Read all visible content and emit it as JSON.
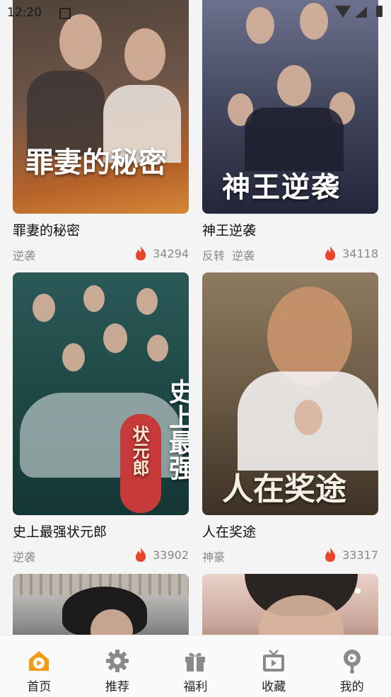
{
  "status": {
    "time": "12:20"
  },
  "cards": [
    {
      "title": "罪妻的秘密",
      "tags": [
        "逆袭"
      ],
      "views": "34294",
      "poster_text": "罪妻的秘密",
      "poster_colors": [
        "#5c4a3e",
        "#b85f2c",
        "#d98a3a"
      ]
    },
    {
      "title": "神王逆袭",
      "tags": [
        "反转",
        "逆袭"
      ],
      "views": "34118",
      "poster_text": "神王逆袭",
      "poster_colors": [
        "#3b3f55",
        "#6a6f87",
        "#2a2d3e"
      ]
    },
    {
      "title": "史上最强状元郎",
      "tags": [
        "逆袭"
      ],
      "views": "33902",
      "poster_text": "史上最强",
      "poster_sub": "状元郎",
      "poster_colors": [
        "#1f4a48",
        "#2f6f6a",
        "#c73a3a"
      ]
    },
    {
      "title": "人在奖途",
      "tags": [
        "神豪"
      ],
      "views": "33317",
      "poster_text": "人在奖途",
      "poster_colors": [
        "#6b5a45",
        "#9a8466",
        "#3e3226"
      ]
    },
    {
      "title": "",
      "tags": [],
      "views": "",
      "poster_colors": [
        "#8f8f8f",
        "#d8d3cd",
        "#4a4a4a"
      ]
    },
    {
      "title": "",
      "tags": [],
      "views": "",
      "poster_colors": [
        "#c9a59a",
        "#e9d2c8",
        "#2a2422"
      ]
    }
  ],
  "tabs": [
    {
      "label": "首页",
      "icon": "home-play-icon",
      "active": true
    },
    {
      "label": "推荐",
      "icon": "gear-icon",
      "active": false
    },
    {
      "label": "福利",
      "icon": "gift-icon",
      "active": false
    },
    {
      "label": "收藏",
      "icon": "tv-icon",
      "active": false
    },
    {
      "label": "我的",
      "icon": "profile-icon",
      "active": false
    }
  ],
  "colors": {
    "accent": "#f39c12",
    "flame": "#e8452c",
    "inactive_icon": "#8a8a8a"
  }
}
